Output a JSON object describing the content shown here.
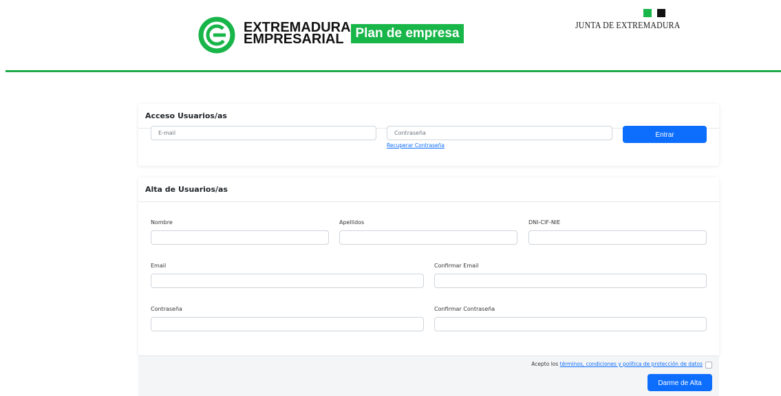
{
  "header": {
    "brand_line1": "EXTREMADURA",
    "brand_line2": "EMPRESARIAL",
    "plan_badge": "Plan de empresa",
    "junta_text": "JUNTA DE EXTREMADURA",
    "colors": {
      "brand_green": "#18b549",
      "rule_green": "#1dab47",
      "junta_dark": "#111111"
    }
  },
  "login": {
    "title": "Acceso Usuarios/as",
    "email_placeholder": "E-mail",
    "password_placeholder": "Contraseña",
    "recover_link": "Recuperar Contraseña",
    "submit_label": "Entrar"
  },
  "signup": {
    "title": "Alta de Usuarios/as",
    "fields": {
      "nombre": "Nombre",
      "apellidos": "Apellidos",
      "dni": "DNI-CIF-NIE",
      "email": "Email",
      "confirm_email": "Confirmar Email",
      "password": "Contraseña",
      "confirm_password": "Confirmar Contraseña"
    },
    "terms_prefix": "Acepto los ",
    "terms_link": "términos, condiciones y política de protección de datos",
    "submit_label": "Darme de Alta"
  },
  "accent_color": "#0d6efd"
}
